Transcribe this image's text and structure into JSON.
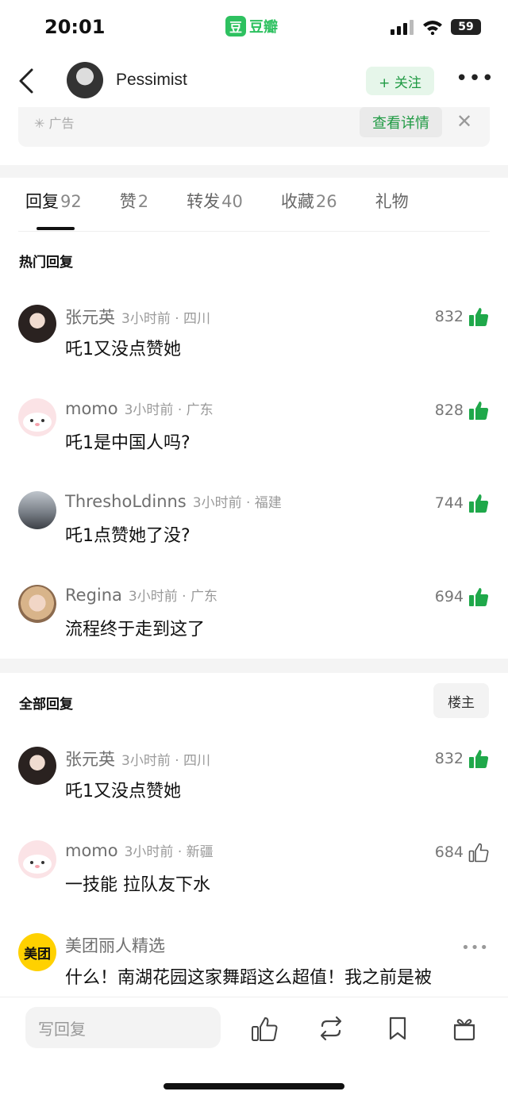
{
  "status": {
    "time": "20:01",
    "app_logo": "豆",
    "app_name": "豆瓣",
    "battery": "59"
  },
  "nav": {
    "user_name": "Pessimist",
    "follow_label": "+ 关注",
    "more_label": "•••"
  },
  "ad": {
    "label": "广告",
    "detail_label": "查看详情",
    "close_label": "✕"
  },
  "tabs": [
    {
      "label": "回复",
      "count": "92"
    },
    {
      "label": "赞",
      "count": "2"
    },
    {
      "label": "转发",
      "count": "40"
    },
    {
      "label": "收藏",
      "count": "26"
    },
    {
      "label": "礼物",
      "count": ""
    }
  ],
  "hot": {
    "title": "热门回复",
    "comments": [
      {
        "user": "张元英",
        "meta": "3小时前 · 四川",
        "text": "吒1又没点赞她",
        "likes": "832",
        "liked": true
      },
      {
        "user": "momo",
        "meta": "3小时前 · 广东",
        "text": "吒1是中国人吗?",
        "likes": "828",
        "liked": true
      },
      {
        "user": "ThreshoLdinns",
        "meta": "3小时前 · 福建",
        "text": "吒1点赞她了没?",
        "likes": "744",
        "liked": true
      },
      {
        "user": "Regina",
        "meta": "3小时前 · 广东",
        "text": "流程终于走到这了",
        "likes": "694",
        "liked": true
      }
    ]
  },
  "all": {
    "title": "全部回复",
    "owner_label": "楼主",
    "comments": [
      {
        "user": "张元英",
        "meta": "3小时前 · 四川",
        "text": "吒1又没点赞她",
        "likes": "832",
        "liked": true
      },
      {
        "user": "momo",
        "meta": "3小时前 · 新疆",
        "text": "一技能 拉队友下水",
        "likes": "684",
        "liked": false
      }
    ],
    "ad_comment": {
      "avatar_text": "美团",
      "user": "美团丽人精选",
      "text": "什么！南湖花园这家舞蹈这么超值！我之前是被",
      "more": "•••"
    }
  },
  "bottom": {
    "reply_placeholder": "写回复"
  },
  "colors": {
    "accent_green": "#2ec160",
    "like_green": "#1fa84a"
  }
}
